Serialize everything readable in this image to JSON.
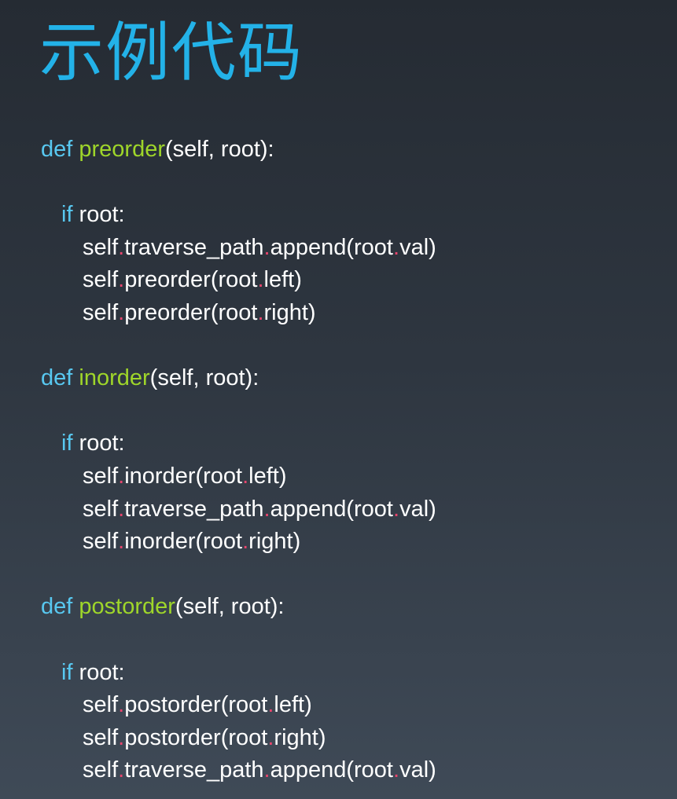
{
  "slide": {
    "title": "示例代码"
  },
  "code": {
    "kw_def": "def",
    "kw_if": "if",
    "dot": ".",
    "fn_preorder": "preorder",
    "fn_inorder": "inorder",
    "fn_postorder": "postorder",
    "params": "(self, root):",
    "if_cond": " root:",
    "self": "self",
    "traverse_path": "traverse_path",
    "append_open": "append(root",
    "val_close": "val)",
    "preorder_open": "preorder(root",
    "inorder_open": "inorder(root",
    "postorder_open": "postorder(root",
    "left_close": "left)",
    "right_close": "right)"
  },
  "colors": {
    "background_top": "#252b33",
    "background_bottom": "#3f4a57",
    "title": "#23b2e8",
    "keyword": "#58c8f0",
    "function_name": "#9fd62a",
    "dot": "#e8456d",
    "text": "#ffffff"
  }
}
